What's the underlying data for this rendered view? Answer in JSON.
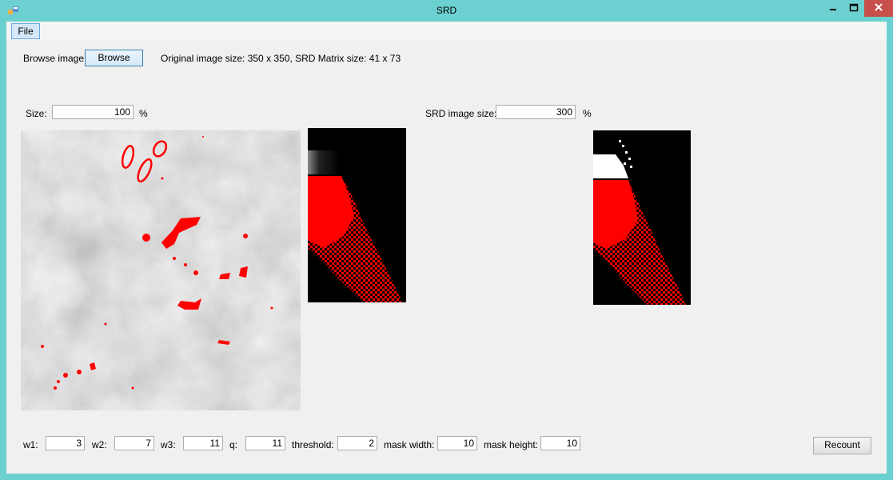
{
  "window": {
    "title": "SRD"
  },
  "menu": {
    "file": "File"
  },
  "top": {
    "browse_label": "Browse image:",
    "browse_button": "Browse",
    "info": "Original image size: 350 x 350, SRD Matrix size: 41 x 73"
  },
  "size": {
    "label": "Size:",
    "value": "100",
    "unit": "%"
  },
  "srd_size": {
    "label": "SRD image size:",
    "value": "300",
    "unit": "%"
  },
  "params": {
    "w1": {
      "label": "w1:",
      "value": "3"
    },
    "w2": {
      "label": "w2:",
      "value": "7"
    },
    "w3": {
      "label": "w3:",
      "value": "11"
    },
    "q": {
      "label": "q:",
      "value": "11"
    },
    "threshold": {
      "label": "threshold:",
      "value": "2"
    },
    "mask_width": {
      "label": "mask width:",
      "value": "10"
    },
    "mask_height": {
      "label": "mask height:",
      "value": "10"
    }
  },
  "recount_button": "Recount",
  "colors": {
    "window_frame": "#6cd0d0",
    "highlight": "#ff0000",
    "client_bg": "#f0f0f0"
  }
}
